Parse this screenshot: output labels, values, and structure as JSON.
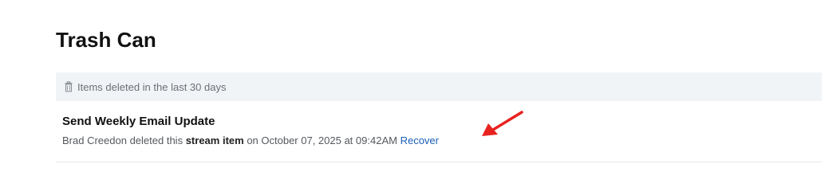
{
  "page": {
    "title": "Trash Can"
  },
  "notice": {
    "icon": "trash-icon",
    "text": "Items deleted in the last 30 days"
  },
  "items": [
    {
      "title": "Send Weekly Email Update",
      "user": "Brad Creedon",
      "action_prefix": "deleted this",
      "item_type": "stream item",
      "date_text": "on October 07, 2025 at 09:42AM",
      "recover_label": "Recover"
    }
  ],
  "annotation": {
    "arrow_color": "#e8231f"
  }
}
